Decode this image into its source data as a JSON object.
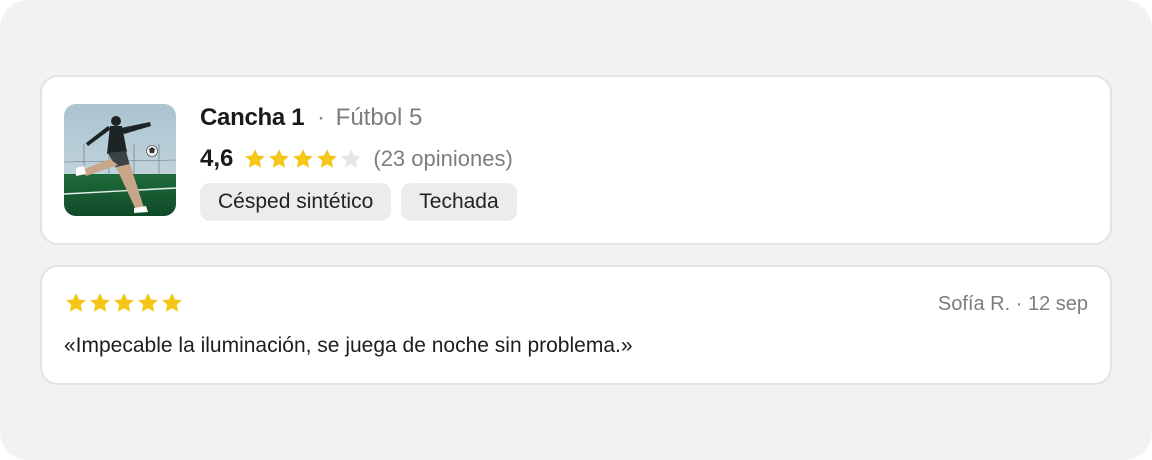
{
  "field": {
    "name": "Cancha 1",
    "separator": "·",
    "type": "Fútbol 5",
    "image_icon": "soccer-player-photo",
    "rating_value": "4,6",
    "rating_stars": 4,
    "rating_max": 5,
    "reviews_count": "(23 opiniones)",
    "tags": [
      "Césped sintético",
      "Techada"
    ]
  },
  "review": {
    "stars": 5,
    "stars_max": 5,
    "meta": "Sofía R. · 12 sep",
    "text": "«Impecable la iluminación, se juega de noche sin problema.»"
  },
  "colors": {
    "star_filled": "#f5c518",
    "star_empty": "#e6e6e6",
    "panel_bg": "#f2f2f2"
  }
}
